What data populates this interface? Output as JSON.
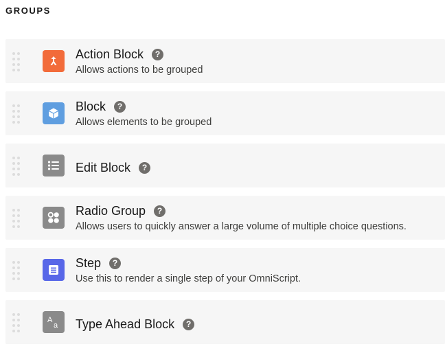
{
  "section": {
    "title": "GROUPS"
  },
  "colors": {
    "action_block": "#f26b3a",
    "block": "#5f9ee0",
    "edit_block": "#8a8a8a",
    "radio_group": "#8a8a8a",
    "step": "#5867e8",
    "type_ahead_block": "#8a8a8a",
    "help_icon": "#706e6b"
  },
  "items": [
    {
      "title": "Action Block",
      "description": "Allows actions to be grouped",
      "icon": "merge-arrows-icon",
      "help": "?"
    },
    {
      "title": "Block",
      "description": "Allows elements to be grouped",
      "icon": "cube-icon",
      "help": "?"
    },
    {
      "title": "Edit Block",
      "description": "",
      "icon": "list-icon",
      "help": "?"
    },
    {
      "title": "Radio Group",
      "description": "Allows users to quickly answer a large volume of multiple choice questions.",
      "icon": "radio-group-icon",
      "help": "?"
    },
    {
      "title": "Step",
      "description": "Use this to render a single step of your OmniScript.",
      "icon": "form-icon",
      "help": "?"
    },
    {
      "title": "Type Ahead Block",
      "description": "",
      "icon": "type-ahead-icon",
      "help": "?",
      "icon_text_big": "A",
      "icon_text_small": "a"
    }
  ]
}
